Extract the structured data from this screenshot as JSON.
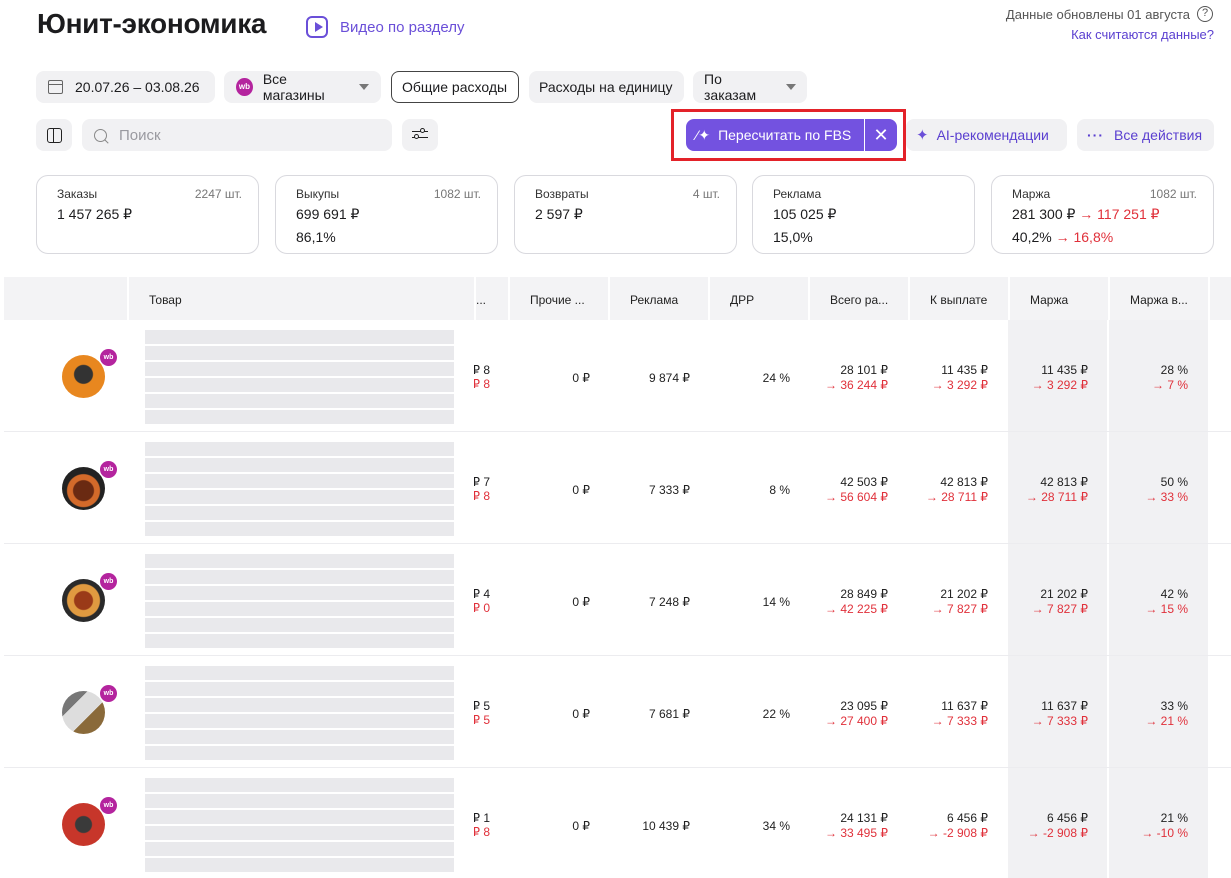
{
  "header": {
    "title": "Юнит-экономика",
    "video_link": "Видео по разделу",
    "updated": "Данные обновлены 01 августа",
    "how_link": "Как считаются данные?"
  },
  "filters": {
    "date_range": "20.07.26 – 03.08.26",
    "stores": "Все магазины",
    "stores_badge": "wb",
    "general_expenses": "Общие расходы",
    "unit_expenses": "Расходы на единицу",
    "by_orders": "По заказам"
  },
  "toolbar": {
    "search_placeholder": "Поиск",
    "recalc_fbs": "Пересчитать по FBS",
    "ai_recommendations": "AI-рекомендации",
    "all_actions": "Все действия"
  },
  "cards": [
    {
      "label": "Заказы",
      "count": "2247 шт.",
      "value": "1 457 265 ₽",
      "pct": "",
      "value_new": "",
      "pct_new": ""
    },
    {
      "label": "Выкупы",
      "count": "1082 шт.",
      "value": "699 691 ₽",
      "pct": "86,1%",
      "value_new": "",
      "pct_new": ""
    },
    {
      "label": "Возвраты",
      "count": "4 шт.",
      "value": "2 597 ₽",
      "pct": "",
      "value_new": "",
      "pct_new": ""
    },
    {
      "label": "Реклама",
      "count": "",
      "value": "105 025 ₽",
      "pct": "15,0%",
      "value_new": "",
      "pct_new": ""
    },
    {
      "label": "Маржа",
      "count": "1082 шт.",
      "value": "281 300 ₽",
      "pct": "40,2%",
      "value_new": "→ 117 251 ₽",
      "pct_new": "→ 16,8%"
    }
  ],
  "table": {
    "headers": [
      "Товар",
      "...",
      "Прочие ...",
      "Реклама",
      "ДРР",
      "Всего ра...",
      "К выплате",
      "Маржа",
      "Маржа в..."
    ],
    "rows": [
      {
        "cut_a": "8 ₽",
        "cut_b": "8 ₽",
        "other": "0 ₽",
        "ads": "9 874 ₽",
        "drr": "24 %",
        "total": "28 101 ₽",
        "total_new": "→ 36 244 ₽",
        "payout": "11 435 ₽",
        "payout_new": "→ 3 292 ₽",
        "margin": "11 435 ₽",
        "margin_new": "→ 3 292 ₽",
        "margin_pct": "28 %",
        "margin_pct_new": "→ 7 %"
      },
      {
        "cut_a": "7 ₽",
        "cut_b": "8 ₽",
        "other": "0 ₽",
        "ads": "7 333 ₽",
        "drr": "8 %",
        "total": "42 503 ₽",
        "total_new": "→ 56 604 ₽",
        "payout": "42 813 ₽",
        "payout_new": "→ 28 711 ₽",
        "margin": "42 813 ₽",
        "margin_new": "→ 28 711 ₽",
        "margin_pct": "50 %",
        "margin_pct_new": "→ 33 %"
      },
      {
        "cut_a": "4 ₽",
        "cut_b": "0 ₽",
        "other": "0 ₽",
        "ads": "7 248 ₽",
        "drr": "14 %",
        "total": "28 849 ₽",
        "total_new": "→ 42 225 ₽",
        "payout": "21 202 ₽",
        "payout_new": "→ 7 827 ₽",
        "margin": "21 202 ₽",
        "margin_new": "→ 7 827 ₽",
        "margin_pct": "42 %",
        "margin_pct_new": "→ 15 %"
      },
      {
        "cut_a": "5 ₽",
        "cut_b": "5 ₽",
        "other": "0 ₽",
        "ads": "7 681 ₽",
        "drr": "22 %",
        "total": "23 095 ₽",
        "total_new": "→ 27 400 ₽",
        "payout": "11 637 ₽",
        "payout_new": "→ 7 333 ₽",
        "margin": "11 637 ₽",
        "margin_new": "→ 7 333 ₽",
        "margin_pct": "33 %",
        "margin_pct_new": "→ 21 %"
      },
      {
        "cut_a": "1 ₽",
        "cut_b": "8 ₽",
        "other": "0 ₽",
        "ads": "10 439 ₽",
        "drr": "34 %",
        "total": "24 131 ₽",
        "total_new": "→ 33 495 ₽",
        "payout": "6 456 ₽",
        "payout_new": "→ -2 908 ₽",
        "margin": "6 456 ₽",
        "margin_new": "→ -2 908 ₽",
        "margin_pct": "21 %",
        "margin_pct_new": "→ -10 %"
      }
    ],
    "badge": "wb"
  },
  "colors": {
    "accent": "#7352e0",
    "link": "#5a3fd0",
    "negative": "#e0303a",
    "highlight_box": "#e32229",
    "wb_brand": "#b4249e"
  }
}
